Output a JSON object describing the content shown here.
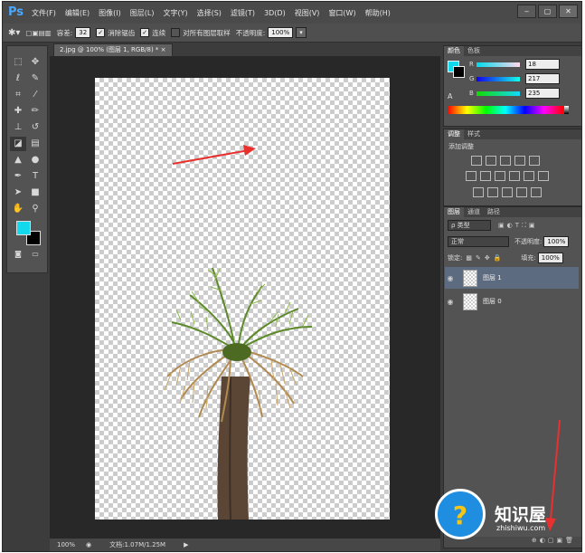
{
  "app": {
    "logo": "Ps"
  },
  "menu": [
    "文件(F)",
    "编辑(E)",
    "图像(I)",
    "图层(L)",
    "文字(Y)",
    "选择(S)",
    "滤镜(T)",
    "3D(D)",
    "视图(V)",
    "窗口(W)",
    "帮助(H)"
  ],
  "window_buttons": [
    "‒",
    "▢",
    "✕"
  ],
  "options": {
    "size_label": "容差:",
    "size_value": "32",
    "antialias": "消除锯齿",
    "contiguous": "连续",
    "all_layers": "对所有图层取样",
    "opacity_label": "不透明度:",
    "opacity_value": "100%"
  },
  "document": {
    "tab": "2.jpg @ 100% (图层 1, RGB/8) * ×",
    "zoom": "100%",
    "doc_size": "文档:1.07M/1.25M"
  },
  "color_panel": {
    "tabs": [
      "颜色",
      "色板"
    ],
    "r_label": "R",
    "r_value": "18",
    "g_label": "G",
    "g_value": "217",
    "b_label": "B",
    "b_value": "235",
    "foreground": "#12d9eb"
  },
  "adjustments_panel": {
    "tabs": [
      "调整",
      "样式"
    ],
    "title": "添加调整"
  },
  "layers_panel": {
    "tabs": [
      "图层",
      "通道",
      "路径"
    ],
    "filter_label": "ρ 类型",
    "blend_mode": "正常",
    "opacity_label": "不透明度:",
    "opacity_value": "100%",
    "lock_label": "锁定:",
    "fill_label": "填充:",
    "fill_value": "100%",
    "layers": [
      {
        "name": "图层 1",
        "selected": true
      },
      {
        "name": "图层 0",
        "selected": false
      }
    ]
  },
  "watermark": {
    "name": "知识屋",
    "url": "zhishiwu.com"
  },
  "colors": {
    "arrow": "#e8312f",
    "selected_layer": "#5d6b80"
  }
}
